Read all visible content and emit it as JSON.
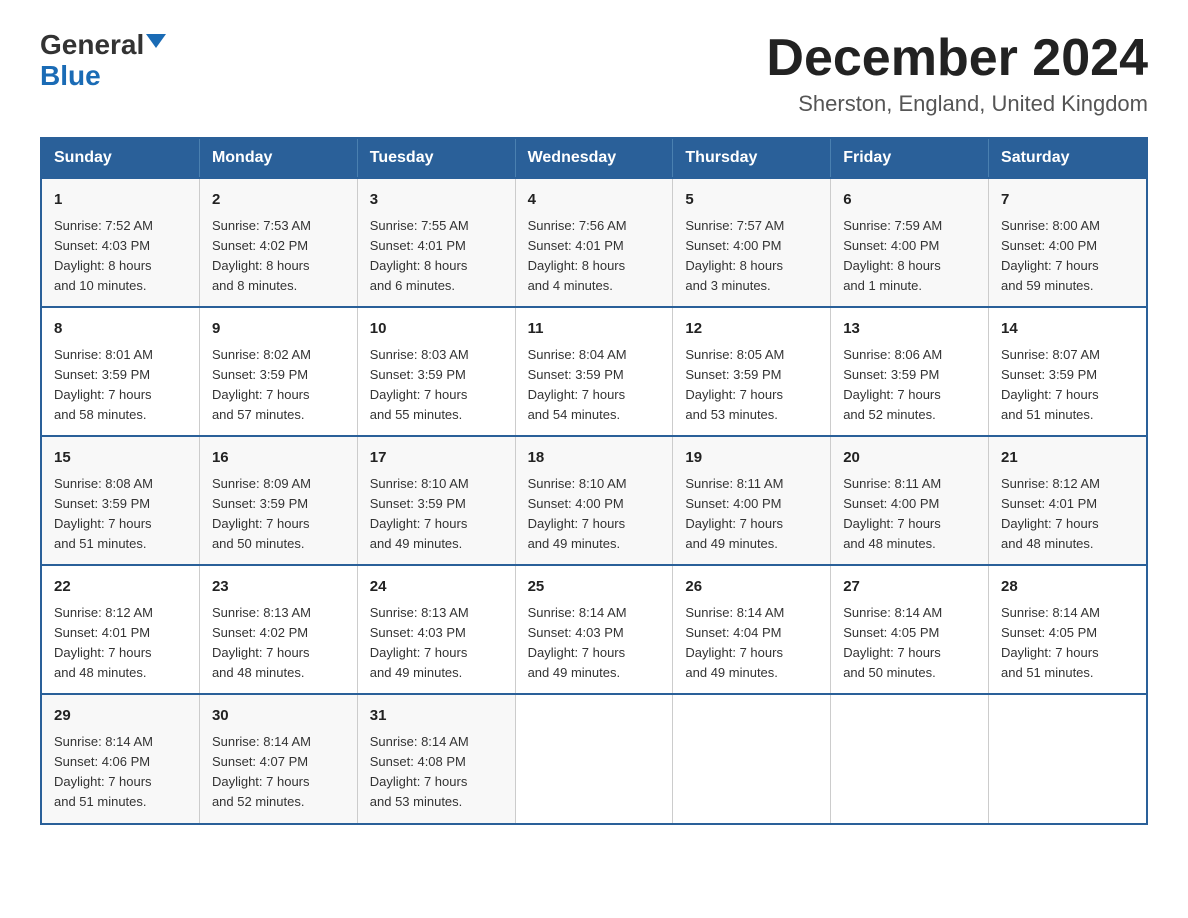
{
  "logo": {
    "text_general": "General",
    "text_blue": "Blue"
  },
  "header": {
    "month": "December 2024",
    "location": "Sherston, England, United Kingdom"
  },
  "weekdays": [
    "Sunday",
    "Monday",
    "Tuesday",
    "Wednesday",
    "Thursday",
    "Friday",
    "Saturday"
  ],
  "weeks": [
    [
      {
        "day": "1",
        "sunrise": "7:52 AM",
        "sunset": "4:03 PM",
        "daylight": "8 hours and 10 minutes."
      },
      {
        "day": "2",
        "sunrise": "7:53 AM",
        "sunset": "4:02 PM",
        "daylight": "8 hours and 8 minutes."
      },
      {
        "day": "3",
        "sunrise": "7:55 AM",
        "sunset": "4:01 PM",
        "daylight": "8 hours and 6 minutes."
      },
      {
        "day": "4",
        "sunrise": "7:56 AM",
        "sunset": "4:01 PM",
        "daylight": "8 hours and 4 minutes."
      },
      {
        "day": "5",
        "sunrise": "7:57 AM",
        "sunset": "4:00 PM",
        "daylight": "8 hours and 3 minutes."
      },
      {
        "day": "6",
        "sunrise": "7:59 AM",
        "sunset": "4:00 PM",
        "daylight": "8 hours and 1 minute."
      },
      {
        "day": "7",
        "sunrise": "8:00 AM",
        "sunset": "4:00 PM",
        "daylight": "7 hours and 59 minutes."
      }
    ],
    [
      {
        "day": "8",
        "sunrise": "8:01 AM",
        "sunset": "3:59 PM",
        "daylight": "7 hours and 58 minutes."
      },
      {
        "day": "9",
        "sunrise": "8:02 AM",
        "sunset": "3:59 PM",
        "daylight": "7 hours and 57 minutes."
      },
      {
        "day": "10",
        "sunrise": "8:03 AM",
        "sunset": "3:59 PM",
        "daylight": "7 hours and 55 minutes."
      },
      {
        "day": "11",
        "sunrise": "8:04 AM",
        "sunset": "3:59 PM",
        "daylight": "7 hours and 54 minutes."
      },
      {
        "day": "12",
        "sunrise": "8:05 AM",
        "sunset": "3:59 PM",
        "daylight": "7 hours and 53 minutes."
      },
      {
        "day": "13",
        "sunrise": "8:06 AM",
        "sunset": "3:59 PM",
        "daylight": "7 hours and 52 minutes."
      },
      {
        "day": "14",
        "sunrise": "8:07 AM",
        "sunset": "3:59 PM",
        "daylight": "7 hours and 51 minutes."
      }
    ],
    [
      {
        "day": "15",
        "sunrise": "8:08 AM",
        "sunset": "3:59 PM",
        "daylight": "7 hours and 51 minutes."
      },
      {
        "day": "16",
        "sunrise": "8:09 AM",
        "sunset": "3:59 PM",
        "daylight": "7 hours and 50 minutes."
      },
      {
        "day": "17",
        "sunrise": "8:10 AM",
        "sunset": "3:59 PM",
        "daylight": "7 hours and 49 minutes."
      },
      {
        "day": "18",
        "sunrise": "8:10 AM",
        "sunset": "4:00 PM",
        "daylight": "7 hours and 49 minutes."
      },
      {
        "day": "19",
        "sunrise": "8:11 AM",
        "sunset": "4:00 PM",
        "daylight": "7 hours and 49 minutes."
      },
      {
        "day": "20",
        "sunrise": "8:11 AM",
        "sunset": "4:00 PM",
        "daylight": "7 hours and 48 minutes."
      },
      {
        "day": "21",
        "sunrise": "8:12 AM",
        "sunset": "4:01 PM",
        "daylight": "7 hours and 48 minutes."
      }
    ],
    [
      {
        "day": "22",
        "sunrise": "8:12 AM",
        "sunset": "4:01 PM",
        "daylight": "7 hours and 48 minutes."
      },
      {
        "day": "23",
        "sunrise": "8:13 AM",
        "sunset": "4:02 PM",
        "daylight": "7 hours and 48 minutes."
      },
      {
        "day": "24",
        "sunrise": "8:13 AM",
        "sunset": "4:03 PM",
        "daylight": "7 hours and 49 minutes."
      },
      {
        "day": "25",
        "sunrise": "8:14 AM",
        "sunset": "4:03 PM",
        "daylight": "7 hours and 49 minutes."
      },
      {
        "day": "26",
        "sunrise": "8:14 AM",
        "sunset": "4:04 PM",
        "daylight": "7 hours and 49 minutes."
      },
      {
        "day": "27",
        "sunrise": "8:14 AM",
        "sunset": "4:05 PM",
        "daylight": "7 hours and 50 minutes."
      },
      {
        "day": "28",
        "sunrise": "8:14 AM",
        "sunset": "4:05 PM",
        "daylight": "7 hours and 51 minutes."
      }
    ],
    [
      {
        "day": "29",
        "sunrise": "8:14 AM",
        "sunset": "4:06 PM",
        "daylight": "7 hours and 51 minutes."
      },
      {
        "day": "30",
        "sunrise": "8:14 AM",
        "sunset": "4:07 PM",
        "daylight": "7 hours and 52 minutes."
      },
      {
        "day": "31",
        "sunrise": "8:14 AM",
        "sunset": "4:08 PM",
        "daylight": "7 hours and 53 minutes."
      },
      null,
      null,
      null,
      null
    ]
  ],
  "labels": {
    "sunrise": "Sunrise:",
    "sunset": "Sunset:",
    "daylight": "Daylight:"
  }
}
